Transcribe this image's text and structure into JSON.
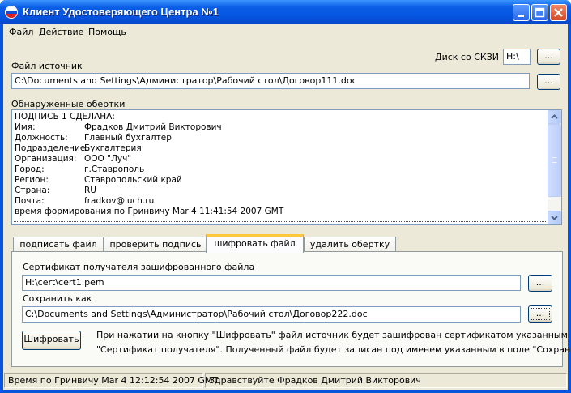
{
  "window": {
    "title": "Клиент Удостоверяющего Центра №1"
  },
  "menu": {
    "items": [
      "Файл",
      "Действие",
      "Помощь"
    ]
  },
  "crypto_disk": {
    "label": "Диск со СКЗИ",
    "value": "H:\\",
    "browse": "..."
  },
  "source_file": {
    "label": "Файл источник",
    "value": "C:\\Documents and Settings\\Администратор\\Рабочий стол\\Договор111.doc",
    "browse": "..."
  },
  "envelopes": {
    "label": "Обнаруженные обертки",
    "header": "ПОДПИСЬ 1   СДЕЛАНА:",
    "rows": [
      {
        "key": "Имя:",
        "value": "Фрадков Дмитрий Викторович"
      },
      {
        "key": "Должность:",
        "value": "Главный бухгалтер"
      },
      {
        "key": "Подразделение:",
        "value": "Бухгалтерия"
      },
      {
        "key": "Организация:",
        "value": "ООО \"Луч\""
      },
      {
        "key": "Город:",
        "value": "г.Ставрополь"
      },
      {
        "key": "Регион:",
        "value": "Ставропольский край"
      },
      {
        "key": "Страна:",
        "value": "RU"
      },
      {
        "key": "Почта:",
        "value": "fradkov@luch.ru"
      }
    ],
    "footer": "время формирования по Гринвичу Mar  4 11:41:54 2007 GMT"
  },
  "tabs": [
    "подписать файл",
    "проверить подпись",
    "шифровать файл",
    "удалить обертку"
  ],
  "active_tab": 2,
  "encrypt": {
    "cert_label": "Сертификат получателя зашифрованного файла",
    "cert_value": "H:\\cert\\cert1.pem",
    "save_label": "Сохранить как",
    "save_value": "C:\\Documents and Settings\\Администратор\\Рабочий стол\\Договор222.doc",
    "browse": "...",
    "encrypt_button": "Шифровать",
    "hint_line1": "При нажатии на кнопку \"Шифровать\"  файл источник будет зашифрован сертификатом указанным в поле",
    "hint_line2": "\"Сертификат получателя\". Полученный файл будет записан под именем указанным в поле \"Сохранить как\"."
  },
  "status": {
    "time": "Время по Гринвичу Mar  4 12:12:54 2007 GMT",
    "greeting": "Здравствуйте Фрадков Дмитрий Викторович"
  }
}
